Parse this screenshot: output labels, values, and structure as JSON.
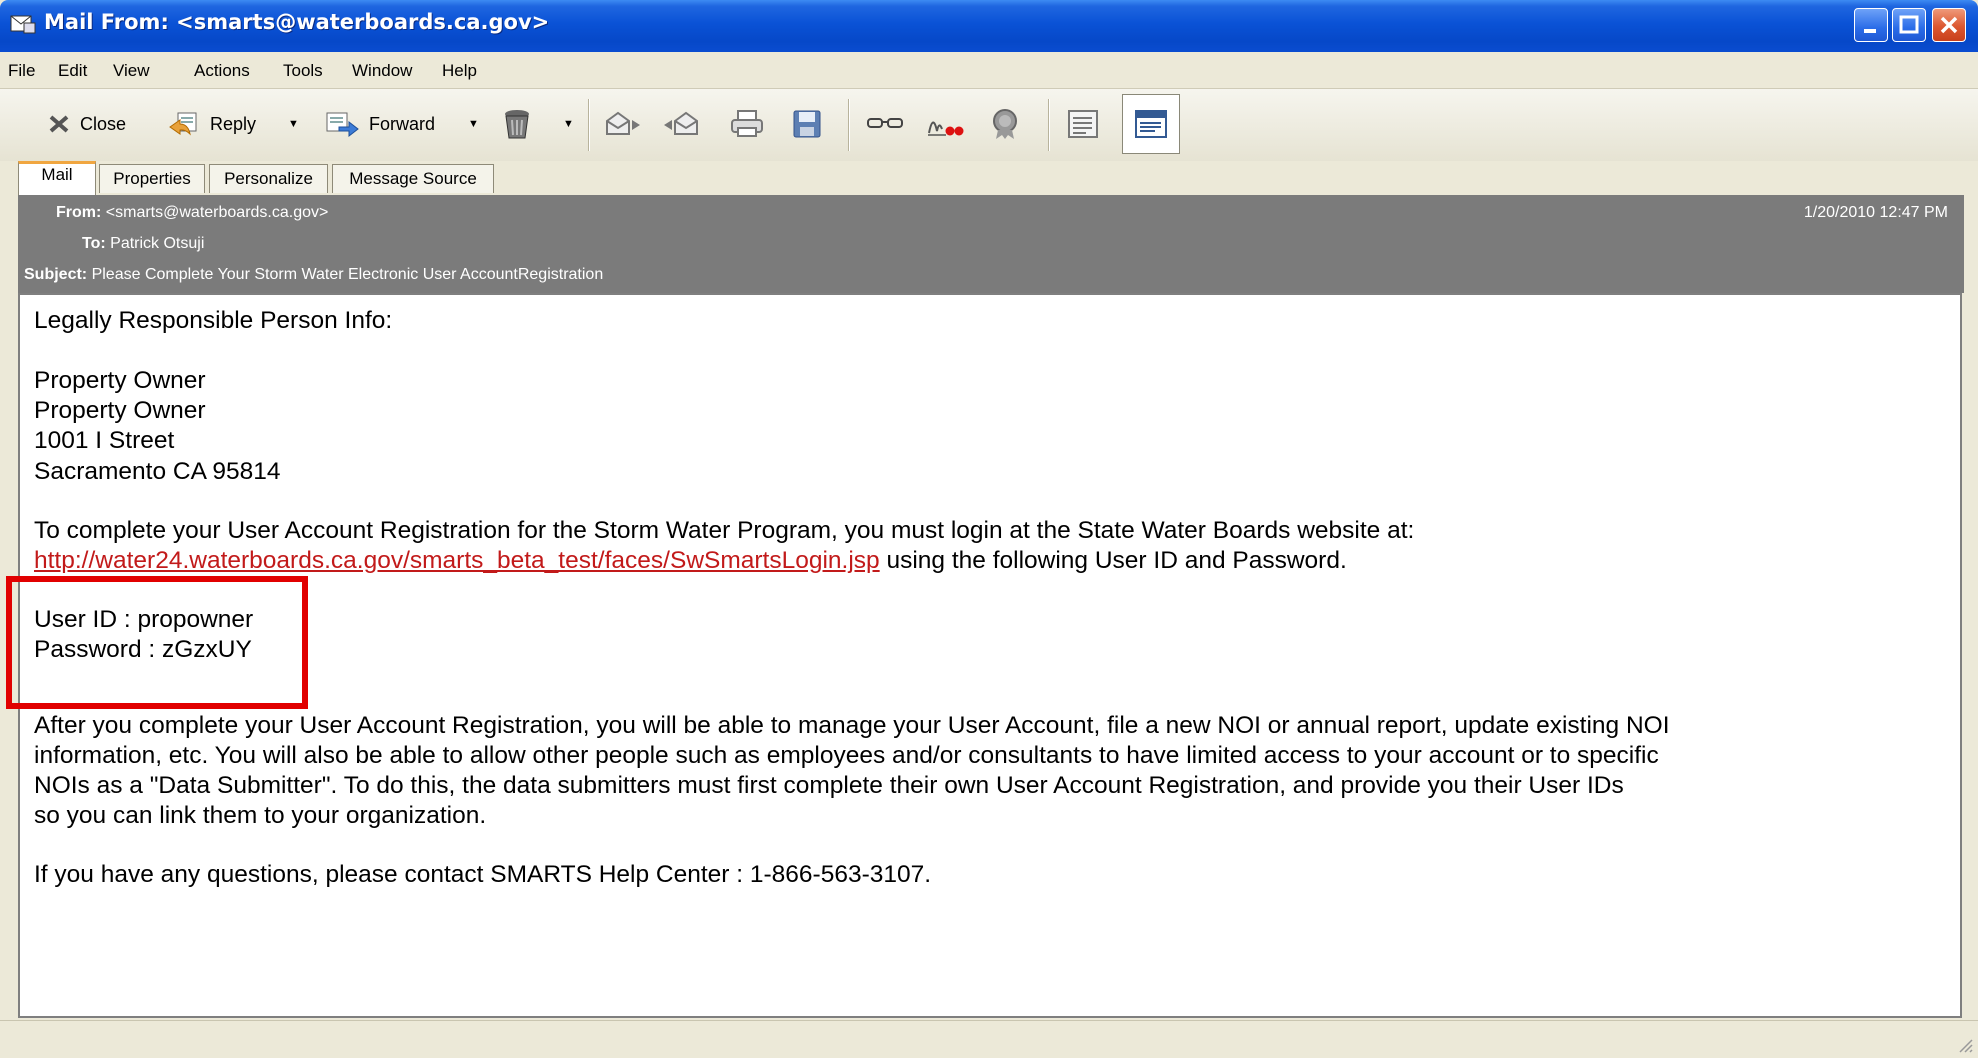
{
  "window": {
    "title": "Mail From: <smarts@waterboards.ca.gov>"
  },
  "menu": [
    "File",
    "Edit",
    "View",
    "Actions",
    "Tools",
    "Window",
    "Help"
  ],
  "toolbar": {
    "close_label": "Close",
    "reply_label": "Reply",
    "forward_label": "Forward"
  },
  "tabs": [
    "Mail",
    "Properties",
    "Personalize",
    "Message Source"
  ],
  "header": {
    "from_label": "From:",
    "from_value": "<smarts@waterboards.ca.gov>",
    "to_label": "To:",
    "to_value": "Patrick Otsuji",
    "subject_label": "Subject:",
    "subject_value": "Please Complete Your Storm Water Electronic User AccountRegistration",
    "date": "1/20/2010 12:47 PM"
  },
  "message": {
    "line1": "Legally Responsible Person Info:",
    "line2": "Property  Owner",
    "line3": "Property Owner",
    "line4": "1001 I Street",
    "line5": "Sacramento CA 95814",
    "line6": "To complete your User Account Registration for the Storm Water Program, you must login at the State Water Boards website at:",
    "link": "http://water24.waterboards.ca.gov/smarts_beta_test/faces/SwSmartsLogin.jsp",
    "line7_suffix": " using the following User ID and Password.",
    "userid": "User ID  : propowner",
    "password": "Password : zGzxUY",
    "para1": "After you complete your User Account Registration, you will be able to manage your User Account, file a new NOI or annual report, update existing NOI",
    "para2": "information, etc. You will also be able to allow other people such as employees and/or consultants to have limited access to your account or to specific",
    "para3": "NOIs as a  \"Data Submitter\".  To do this, the data submitters must first complete their own User Account Registration, and provide you their User IDs",
    "para4": "so you can link them to your organization.",
    "contact": "If you have any questions, please contact SMARTS Help Center : 1-866-563-3107."
  }
}
